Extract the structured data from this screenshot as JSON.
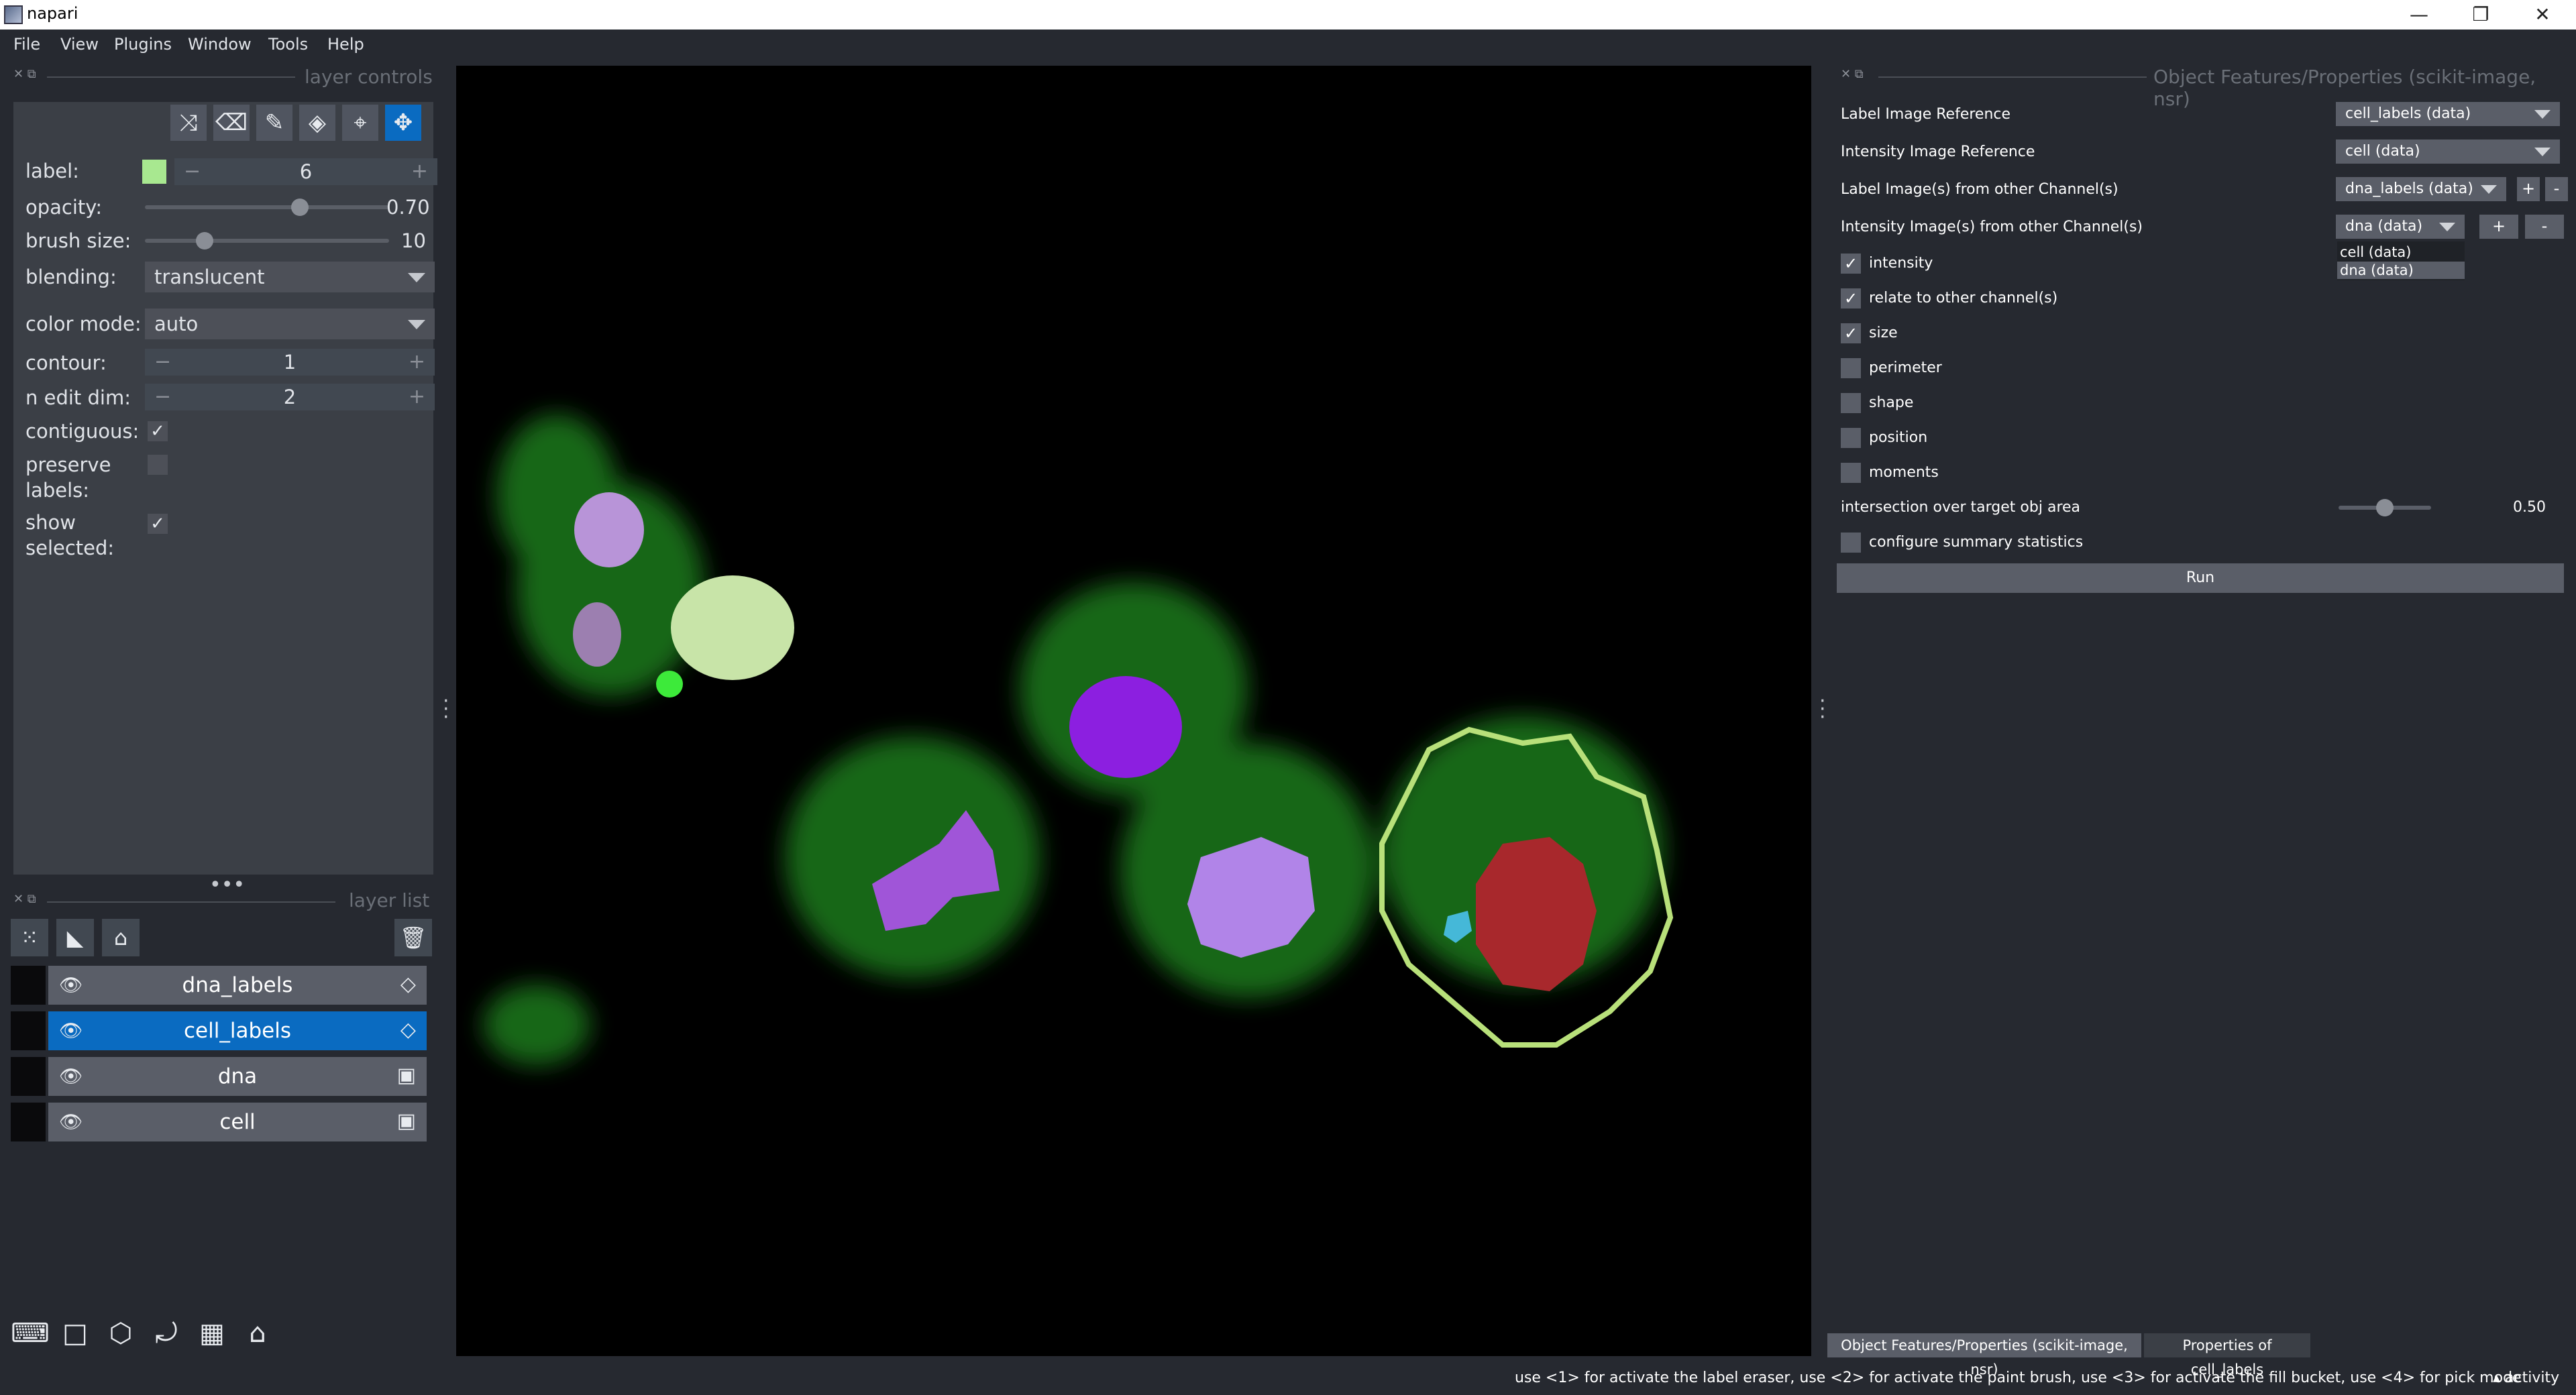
{
  "window": {
    "title": "napari",
    "minimize": "—",
    "restore": "❐",
    "close": "✕"
  },
  "menu": [
    "File",
    "View",
    "Plugins",
    "Window",
    "Tools",
    "Help"
  ],
  "layer_controls": {
    "title": "layer controls",
    "label_label": "label:",
    "label_value": "6",
    "label_color": "#a8e890",
    "opacity_label": "opacity:",
    "opacity_value": "0.70",
    "opacity_fraction": 0.7,
    "brush_label": "brush size:",
    "brush_value": "10",
    "brush_fraction": 0.1,
    "blending_label": "blending:",
    "blending_value": "translucent",
    "color_mode_label": "color mode:",
    "color_mode_value": "auto",
    "contour_label": "contour:",
    "contour_value": "1",
    "n_edit_label": "n edit dim:",
    "n_edit_value": "2",
    "contiguous_label": "contiguous:",
    "preserve_label_1": "preserve",
    "preserve_label_2": "labels:",
    "show_label_1": "show",
    "show_label_2": "selected:",
    "check_mark": "✓",
    "minus": "−",
    "plus": "+"
  },
  "layer_list": {
    "title": "layer list",
    "layers": [
      {
        "name": "dna_labels",
        "type_icon": "label-icon",
        "selected": false
      },
      {
        "name": "cell_labels",
        "type_icon": "label-icon",
        "selected": true
      },
      {
        "name": "dna",
        "type_icon": "image-icon",
        "selected": false
      },
      {
        "name": "cell",
        "type_icon": "image-icon",
        "selected": false
      }
    ]
  },
  "right_widget": {
    "title": "Object Features/Properties (scikit-image, nsr)",
    "label_image_ref_label": "Label Image Reference",
    "label_image_ref_value": "cell_labels (data)",
    "intensity_image_ref_label": "Intensity Image Reference",
    "intensity_image_ref_value": "cell (data)",
    "label_other_label": "Label Image(s) from other Channel(s)",
    "label_other_value": "dna_labels (data)",
    "intensity_other_label": "Intensity Image(s) from other Channel(s)",
    "intensity_other_value": "dna (data)",
    "dropdown_options": [
      "cell (data)",
      "dna (data)"
    ],
    "plus": "+",
    "minus": "-",
    "checks": [
      {
        "label": "intensity",
        "checked": true
      },
      {
        "label": "relate to other channel(s)",
        "checked": true
      },
      {
        "label": "size",
        "checked": true
      },
      {
        "label": "perimeter",
        "checked": false
      },
      {
        "label": "shape",
        "checked": false
      },
      {
        "label": "position",
        "checked": false
      },
      {
        "label": "moments",
        "checked": false
      }
    ],
    "iou_label": "intersection over target obj area",
    "iou_value": "0.50",
    "iou_fraction": 0.5,
    "summary_label": "configure summary statistics",
    "run_label": "Run",
    "check_mark": "✓"
  },
  "tabs": [
    "Object Features/Properties (scikit-image, nsr)",
    "Properties of cell_labels"
  ],
  "status": {
    "hint": "use <1> for activate the label eraser, use <2> for activate the paint brush, use <3> for activate the fill bucket, use <4> for pick mode",
    "activity": "▴ activity"
  },
  "colors": {
    "accent": "#0a6bc1",
    "panel": "#3b3f46",
    "background": "#262930"
  }
}
